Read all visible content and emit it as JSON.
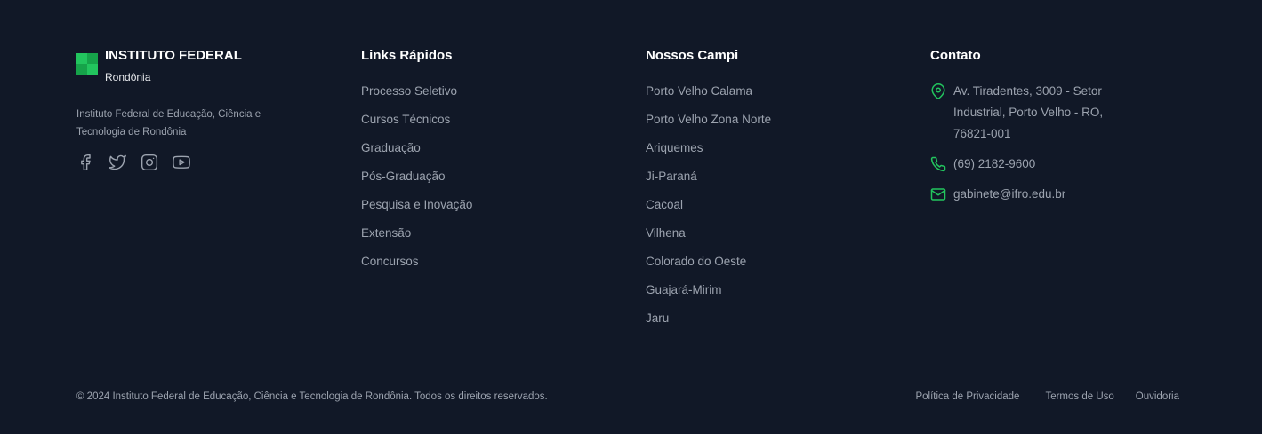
{
  "brand": {
    "title": "INSTITUTO FEDERAL",
    "subtitle": "Rondônia",
    "description": "Instituto Federal de Educação, Ciência e Tecnologia de Rondônia",
    "accent_color": "#22c55e",
    "social_icons": [
      "facebook-icon",
      "twitter-icon",
      "instagram-icon",
      "youtube-icon"
    ]
  },
  "links": {
    "title": "Links Rápidos",
    "items": [
      "Processo Seletivo",
      "Cursos Técnicos",
      "Graduação",
      "Pós-Graduação",
      "Pesquisa e Inovação",
      "Extensão",
      "Concursos"
    ]
  },
  "campi": {
    "title": "Nossos Campi",
    "items": [
      "Porto Velho Calama",
      "Porto Velho Zona Norte",
      "Ariquemes",
      "Ji-Paraná",
      "Cacoal",
      "Vilhena",
      "Colorado do Oeste",
      "Guajará-Mirim",
      "Jaru"
    ]
  },
  "contact": {
    "title": "Contato",
    "address": "Av. Tiradentes, 3009 - Setor Industrial, Porto Velho - RO, 76821-001",
    "phone": "(69) 2182-9600",
    "email": "gabinete@ifro.edu.br"
  },
  "bottom": {
    "copyright": "© 2024 Instituto Federal de Educação, Ciência e Tecnologia de Rondônia. Todos os direitos reservados.",
    "legal": [
      "Política de Privacidade",
      "Termos de Uso",
      "Ouvidoria"
    ]
  },
  "colors": {
    "background": "#111827",
    "text": "#9ca3af",
    "heading": "#ffffff",
    "accent": "#22c55e"
  }
}
